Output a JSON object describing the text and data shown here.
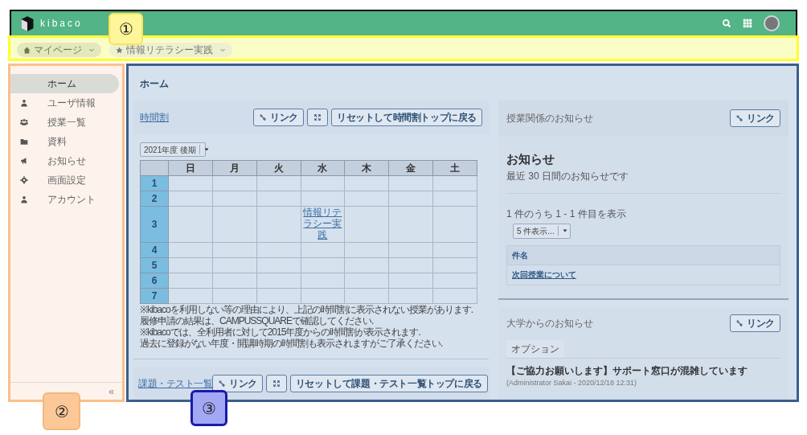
{
  "header": {
    "logo_text": "kibaco"
  },
  "breadcrumbs": [
    {
      "kind": "home",
      "label": "マイページ"
    },
    {
      "kind": "star",
      "label": "情報リテラシー実践"
    }
  ],
  "sidebar": {
    "items": [
      {
        "kind": "none",
        "label": "ホーム",
        "selected": true
      },
      {
        "kind": "user",
        "label": "ユーザ情報",
        "selected": false
      },
      {
        "kind": "group",
        "label": "授業一覧",
        "selected": false
      },
      {
        "kind": "folder",
        "label": "資料",
        "selected": false
      },
      {
        "kind": "megaphone",
        "label": "お知らせ",
        "selected": false
      },
      {
        "kind": "gear",
        "label": "画面設定",
        "selected": false
      },
      {
        "kind": "user",
        "label": "アカウント",
        "selected": false
      }
    ],
    "collapse": "«"
  },
  "main": {
    "title": "ホーム",
    "timetable": {
      "title": "時間割",
      "link_button": "リンク",
      "reset_button": "リセットして時間割トップに戻る",
      "term": "2021年度 後期",
      "columns": [
        "日",
        "月",
        "火",
        "水",
        "木",
        "金",
        "土"
      ],
      "rows": [
        {
          "period": "1",
          "cells": [
            "",
            "",
            "",
            "",
            "",
            "",
            ""
          ]
        },
        {
          "period": "2",
          "cells": [
            "",
            "",
            "",
            "",
            "",
            "",
            ""
          ]
        },
        {
          "period": "3",
          "cells": [
            "",
            "",
            "",
            "情報リテラシー実践",
            "",
            "",
            ""
          ]
        },
        {
          "period": "4",
          "cells": [
            "",
            "",
            "",
            "",
            "",
            "",
            ""
          ]
        },
        {
          "period": "5",
          "cells": [
            "",
            "",
            "",
            "",
            "",
            "",
            ""
          ]
        },
        {
          "period": "6",
          "cells": [
            "",
            "",
            "",
            "",
            "",
            "",
            ""
          ]
        },
        {
          "period": "7",
          "cells": [
            "",
            "",
            "",
            "",
            "",
            "",
            ""
          ]
        }
      ],
      "notes": [
        "※kibacoを利用しない等の理由により、上記の時間割に表示されない授業があります.",
        "履修申請の結果は、CAMPUSSQUAREで確認してください.",
        "※kibacoでは、全利用者に対して2015年度からの時間割が表示されます.",
        "過去に登録がない年度・開講時期の時間割も表示されますがご了承ください."
      ]
    },
    "tasks": {
      "title": "課題・テスト一覧",
      "link_button": "リンク",
      "reset_button": "リセットして課題・テスト一覧トップに戻る"
    },
    "course_notices": {
      "title": "授業関係のお知らせ",
      "link_button": "リンク",
      "heading": "お知らせ",
      "subheading": "最近 30 日間のお知らせです",
      "count": "1 件のうち 1 - 1 件目を表示",
      "page_size": "5 件表示...",
      "column": "件名",
      "rows": [
        "次回授業について"
      ]
    },
    "university_notices": {
      "title": "大学からのお知らせ",
      "link_button": "リンク",
      "tab": "オプション",
      "item_title": "【ご協力お願いします】サポート窓口が混雑しています",
      "item_meta": "(Administrator Sakai - 2020/12/18 12:31)"
    }
  },
  "callouts": [
    {
      "label": "①",
      "color": "#fff59a"
    },
    {
      "label": "②",
      "color": "#fcc898"
    },
    {
      "label": "③",
      "color": "#a3a8f5"
    }
  ]
}
